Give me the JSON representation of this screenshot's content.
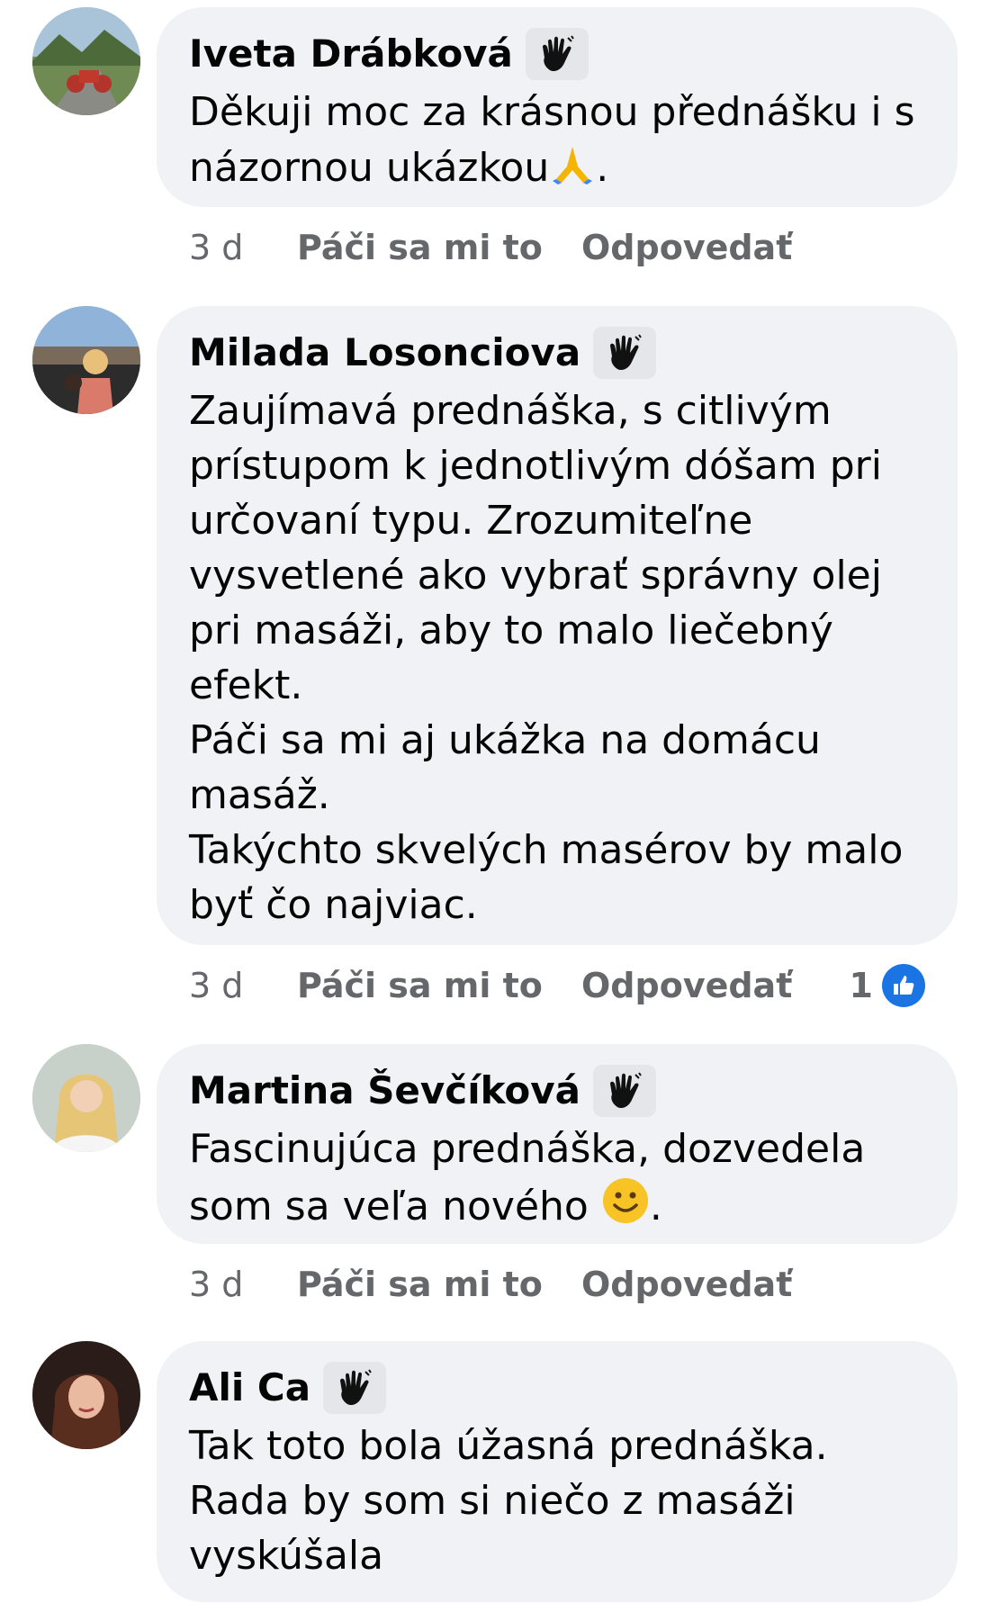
{
  "comments": [
    {
      "author": "Iveta Drábková",
      "text": "Děkuji moc za krásnou přednášku i s názornou ukázkou",
      "text_end": ".",
      "inline_emoji": "folded-hands",
      "time": "3 d",
      "like_label": "Páči sa mi to",
      "reply_label": "Odpovedať"
    },
    {
      "author": "Milada Losonciova",
      "text": "Zaujímavá prednáška, s citlivým prístupom k jednotlivým dóšam pri určovaní typu. Zrozumiteľne vysvetlené ako vybrať správny olej pri masáži, aby to malo liečebný efekt.\nPáči sa mi aj ukážka na domácu masáž.\nTakýchto skvelých masérov by malo byť čo najviac.",
      "time": "3 d",
      "like_label": "Páči sa mi to",
      "reply_label": "Odpovedať",
      "reaction_count": "1"
    },
    {
      "author": "Martina Ševčíková",
      "text": "Fascinujúca prednáška, dozvedela som sa veľa nového ",
      "text_end": ".",
      "inline_emoji": "smiling-face",
      "time": "3 d",
      "like_label": "Páči sa mi to",
      "reply_label": "Odpovedať"
    },
    {
      "author": "Ali Ca",
      "text": "Tak toto bola úžasná prednáška.\nRada by som si niečo z masáži vyskúšala"
    }
  ],
  "colors": {
    "bubble": "#f0f2f5",
    "meta_text": "#65676b",
    "like_blue": "#1b74e4"
  }
}
